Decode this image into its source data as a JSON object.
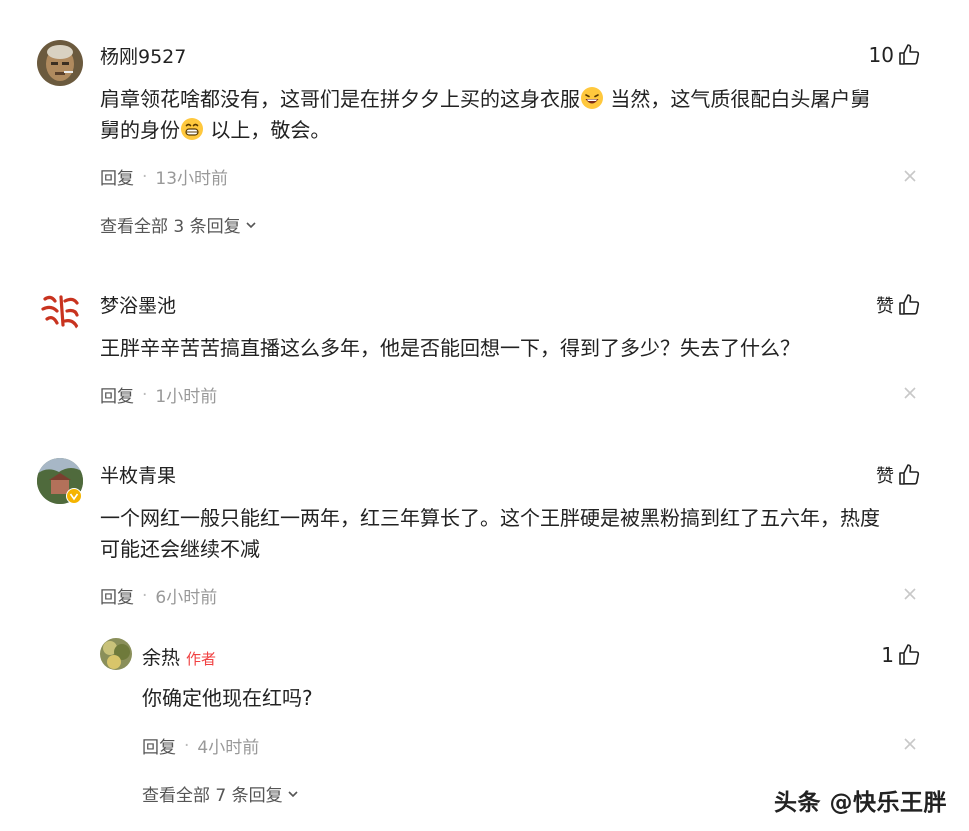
{
  "comments": [
    {
      "username": "杨刚9527",
      "likes": "10",
      "text1": "肩章领花啥都没有，这哥们是在拼夕夕上买的这身衣服",
      "text2": " 当然，这气质很配白头屠户舅",
      "text3": "舅的身份",
      "text4": " 以上，敬会。",
      "reply_label": "回复",
      "time": "13小时前",
      "view_all": "查看全部 3 条回复"
    },
    {
      "username": "梦浴墨池",
      "likes": "赞",
      "text": "王胖辛辛苦苦搞直播这么多年，他是否能回想一下，得到了多少？失去了什么？",
      "reply_label": "回复",
      "time": "1小时前"
    },
    {
      "username": "半枚青果",
      "likes": "赞",
      "text1": "一个网红一般只能红一两年，红三年算长了。这个王胖硬是被黑粉搞到红了五六年，热度",
      "text2": "可能还会继续不减",
      "reply_label": "回复",
      "time": "6小时前"
    }
  ],
  "reply": {
    "username": "余热",
    "author_tag": "作者",
    "likes": "1",
    "text": "你确定他现在红吗?",
    "reply_label": "回复",
    "time": "4小时前",
    "view_all": "查看全部 7 条回复"
  },
  "watermark": "头条 @快乐王胖",
  "colors": {
    "author_tag": "#f04142",
    "meta": "#999999",
    "text": "#222222"
  }
}
